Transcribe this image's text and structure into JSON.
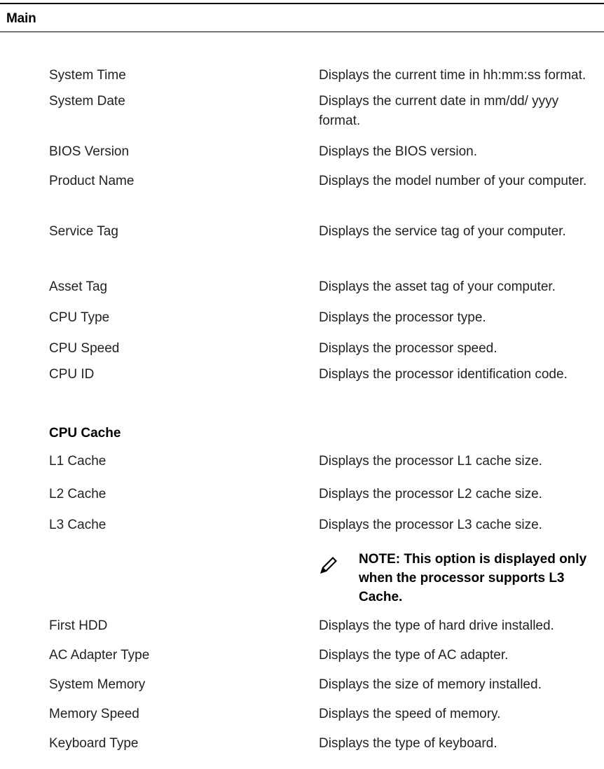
{
  "section": {
    "title": "Main"
  },
  "rows_top": [
    {
      "label": "System Time",
      "desc": "Displays the current time in hh:mm:ss format."
    },
    {
      "label": "System Date",
      "desc": "Displays the current date in mm/dd/ yyyy format."
    },
    {
      "label": "BIOS Version",
      "desc": "Displays the BIOS version."
    },
    {
      "label": "Product Name",
      "desc": "Displays the model number of your computer."
    },
    {
      "label": "Service Tag",
      "desc": "Displays the service tag of your computer."
    },
    {
      "label": "Asset Tag",
      "desc": "Displays the asset tag of your computer."
    },
    {
      "label": "CPU Type",
      "desc": "Displays the processor type."
    },
    {
      "label": "CPU Speed",
      "desc": "Displays the processor speed."
    },
    {
      "label": "CPU ID",
      "desc": "Displays the processor identification code."
    }
  ],
  "cpu_cache": {
    "heading": "CPU Cache",
    "rows": [
      {
        "label": "L1 Cache",
        "desc": "Displays the processor L1 cache size."
      },
      {
        "label": "L2 Cache",
        "desc": "Displays the processor L2 cache size."
      },
      {
        "label": "L3 Cache",
        "desc": "Displays the processor L3 cache size."
      }
    ],
    "note": "NOTE: This option is displayed only when the processor supports L3 Cache.",
    "note_icon": "pencil-note-icon"
  },
  "rows_bottom": [
    {
      "label": "First HDD",
      "desc": "Displays the type of hard drive installed."
    },
    {
      "label": "AC Adapter Type",
      "desc": "Displays the type of AC adapter."
    },
    {
      "label": "System Memory",
      "desc": "Displays the size of memory installed."
    },
    {
      "label": "Memory Speed",
      "desc": "Displays the speed of memory."
    },
    {
      "label": "Keyboard Type",
      "desc": "Displays the type of keyboard."
    }
  ]
}
